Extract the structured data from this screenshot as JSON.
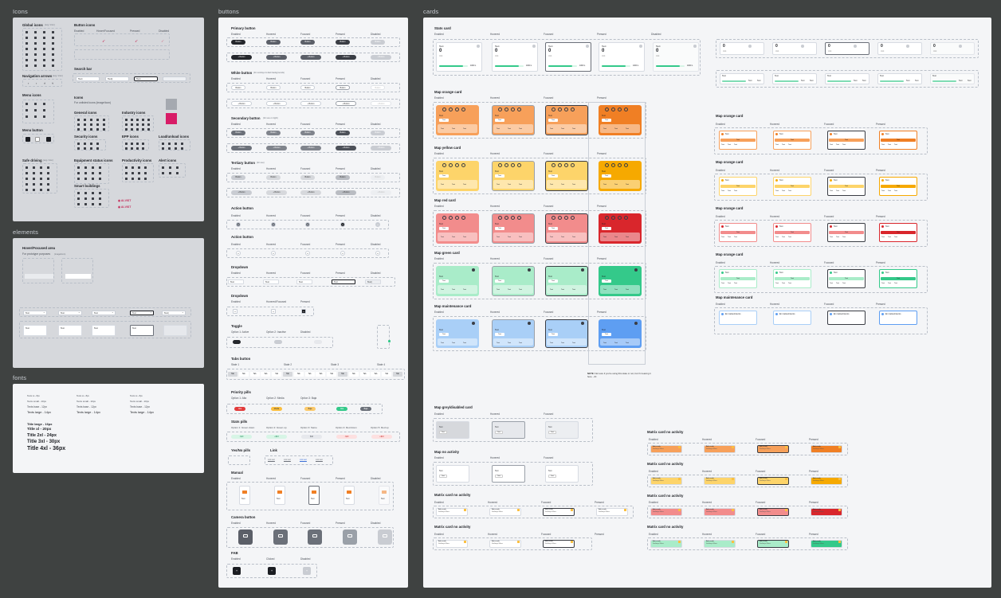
{
  "frames": {
    "icons": "Icons",
    "elements": "elements",
    "fonts": "fonts",
    "buttons": "buttons",
    "cards": "cards"
  },
  "icons": {
    "global_icons": "Global icons",
    "global_icons_note": "(svg / icon)",
    "button_icons": "Button icons",
    "states": [
      "Enabled",
      "Hover/Focused",
      "Pressed",
      "Disabled"
    ],
    "search_bar": "Search bar",
    "search_values": [
      "Text",
      "Text|",
      "Text"
    ],
    "navigation_arrows": "Navigation arrows",
    "navigation_note": "(svg / icon)",
    "menu_icons": "Menu icons",
    "menu_button": "Menu button",
    "icons_label": "Icons",
    "icons_note": "For unlisted icons (image/icon)",
    "general_icons": "General icons",
    "industry_icons": "Industry icons",
    "security_icons": "Security icons",
    "epp_icons": "EPP icons",
    "load_unload_icons": "Load/unload icons",
    "safe_driving": "Safe driving",
    "safe_driving_note": "(svg / icon)",
    "equipment_status_icons": "Equipment status icons",
    "productivity_icons": "Productivity icons",
    "alert_icons": "Alert icons",
    "smart_buildings": "Smart buildings",
    "logo_text": "AI-VIST"
  },
  "elements": {
    "title": "Hover/Focused area",
    "note": "For prototype purposes",
    "note2": "(image/icon)",
    "dropdown_values": [
      "Text",
      "Text",
      "Text",
      "Text",
      "Text|",
      "Text"
    ],
    "inputs": [
      "Text",
      "Text",
      "Text",
      "Text"
    ]
  },
  "fonts": {
    "col1": [
      "Texts xs - 8px",
      "Texts small - 10px",
      "Texts base - 12px"
    ],
    "col2": [
      "Texts xs - 8px",
      "Texts small - 10px",
      "Texts base - 12px"
    ],
    "col3": [
      "Texts xs - 8px",
      "Texts small - 10px",
      "Texts base - 12px"
    ],
    "large": [
      "Texts large - 14px",
      "Texts large - 14px",
      "Texts large - 14px"
    ],
    "titles": [
      "Title large - 16px",
      "Title xl - 20px",
      "Title 2xl - 24px",
      "Title 3xl - 30px",
      "Title 4xl - 36px"
    ]
  },
  "buttons": {
    "states": [
      "Enabled",
      "Hovered",
      "Focused",
      "Pressed",
      "Disabled"
    ],
    "primary": "Primary button",
    "white": "White button",
    "white_note": "(for overlays & dark backgrounds)",
    "secondary": "Secondary button",
    "secondary_note": "(for use on light)",
    "tertiary": "Tertiary button",
    "tertiary_note": "(for use)",
    "btn_text": "Button",
    "action": "Action button",
    "dropdown": "Dropdown",
    "dropdown_values": [
      "Text",
      "Text",
      "Text",
      "Text",
      "Text|",
      "Text"
    ],
    "dropdown2_states": [
      "Enabled",
      "Hovered/Focused",
      "Pressed"
    ],
    "toggle": "Toggle",
    "toggle_options": [
      "Option 1: Active",
      "Option 2: Inactive",
      "Disabled"
    ],
    "tabs": "Tabs button",
    "tab_states": [
      "State 1",
      "State 2",
      "State 3",
      "State 4"
    ],
    "tab_label": "Tab",
    "priority": "Priority pills",
    "priority_options": [
      "Option 1: Alta",
      "Option 2: Media",
      "Option 3: Baja"
    ],
    "priority_labels": [
      "Alta",
      "Media",
      "Baja",
      "Alta",
      "Baja"
    ],
    "stats": "Stats pills",
    "stats_options": [
      "Option 1: Green down",
      "Option 2: Green up",
      "Option 3: Same",
      "Option 4: Red down",
      "Option 5: Red up"
    ],
    "stats_values": [
      "-$10",
      "+$10",
      "$10",
      "-$10",
      "+$10"
    ],
    "yesno": "Yes/No pills",
    "link": "Link",
    "link_values": [
      "Link text",
      "Link text",
      "Link text",
      "Link text"
    ],
    "manual": "Manual",
    "manual_label": "Text",
    "camera": "Camera button",
    "fab": "FAB",
    "fab_states": [
      "Enabled",
      "Clicked",
      "Disabled"
    ]
  },
  "cards": {
    "states": [
      "Enabled",
      "Hovered",
      "Focused",
      "Pressed",
      "Disabled"
    ],
    "stats_card": "Stats card",
    "stat_text": "Text",
    "stat_value": "0",
    "stat_total": "1000 L",
    "stat_unit": "Unit",
    "map_orange": "Map orange card",
    "map_yellow": "Map yellow card",
    "map_red": "Map red card",
    "map_green": "Map green card",
    "map_maintenance": "Map maintenance card",
    "map_grey": "Map grey/disabled card",
    "map_no_activity": "Map no activity",
    "matrix_no_activity": "Matrix card no activity",
    "map_orange_right": "Map orange card",
    "map_orange_right2": "Map orange card",
    "map_orange_right3": "Map orange card",
    "map_green_right": "Map orange card",
    "map_maintenance_right": "Map maintenance card",
    "card_text": "Text",
    "maintenance_text": "En mantenimiento",
    "matrix_line1": "Adecuado",
    "matrix_line2": "Sin/bajo 90ms",
    "note_bold": "NOTE:",
    "note_text": "Not sure if you're using this state or not, but I'm leaving it here. -JC",
    "colors": {
      "orange": "#f7a05a",
      "orange_dark": "#f07f24",
      "yellow": "#fdd46a",
      "yellow_dark": "#f6a900",
      "red": "#f28c8c",
      "red_dark": "#d9262c",
      "green": "#a9ecc9",
      "green_dark": "#34c98a",
      "blue": "#a9cff7",
      "blue_dark": "#5e9ef2",
      "magenta": "#d81c67",
      "grey_swatch": "#a5a9b0"
    }
  }
}
